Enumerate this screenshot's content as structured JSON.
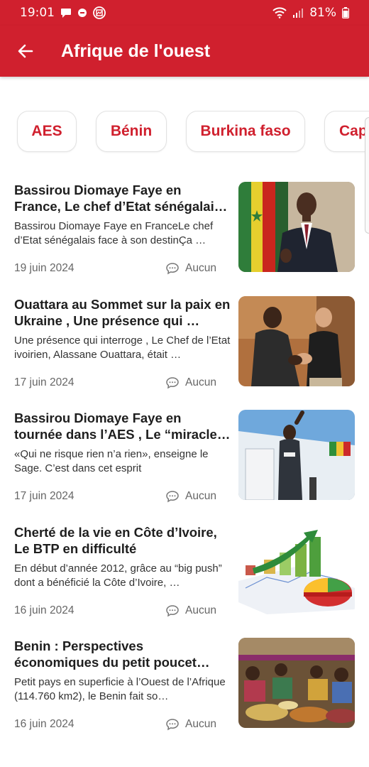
{
  "status": {
    "time": "19:01",
    "battery": "81%"
  },
  "header": {
    "title": "Afrique de l'ouest"
  },
  "chips": [
    {
      "label": "AES"
    },
    {
      "label": "Bénin"
    },
    {
      "label": "Burkina faso"
    },
    {
      "label": "Cap"
    }
  ],
  "articles": [
    {
      "title": "Bassirou Diomaye Faye en France, Le chef d’Etat sénégalais face à …",
      "excerpt": "Bassirou Diomaye Faye en FranceLe chef d’Etat sénégalais face à son destinÇa …",
      "date": "19 juin 2024",
      "comments": "Aucun"
    },
    {
      "title": "Ouattara au Sommet sur la paix en Ukraine , Une présence qui …",
      "excerpt": "Une présence qui interroge , Le Chef de l’Etat ivoirien, Alassane Ouattara, était …",
      "date": "17 juin 2024",
      "comments": "Aucun"
    },
    {
      "title": "Bassirou Diomaye Faye en tournée dans l’AES , Le “miracle” n’aura pa…",
      "excerpt": "«Qui ne risque rien n’a rien», enseigne le Sage. C’est dans  cet esprit",
      "date": "17 juin 2024",
      "comments": "Aucun"
    },
    {
      "title": "Cherté de la vie en Côte d’Ivoire, Le BTP en difficulté",
      "excerpt": "En début d’année 2012, grâce au “big push” dont a bénéficié la Côte d’Ivoire, …",
      "date": "16 juin 2024",
      "comments": "Aucun"
    },
    {
      "title": "Benin : Perspectives économiques du petit poucet d’Afrique",
      "excerpt": "Petit pays en superficie à l’Ouest de l’Afrique (114.760 km2), le Benin fait so…",
      "date": "16 juin 2024",
      "comments": "Aucun"
    }
  ],
  "colors": {
    "brand": "#d0202e",
    "text": "#1e1e1e",
    "muted": "#666666"
  },
  "icons": {
    "back": "arrow-left-icon",
    "comment": "comment-bubble-icon"
  }
}
